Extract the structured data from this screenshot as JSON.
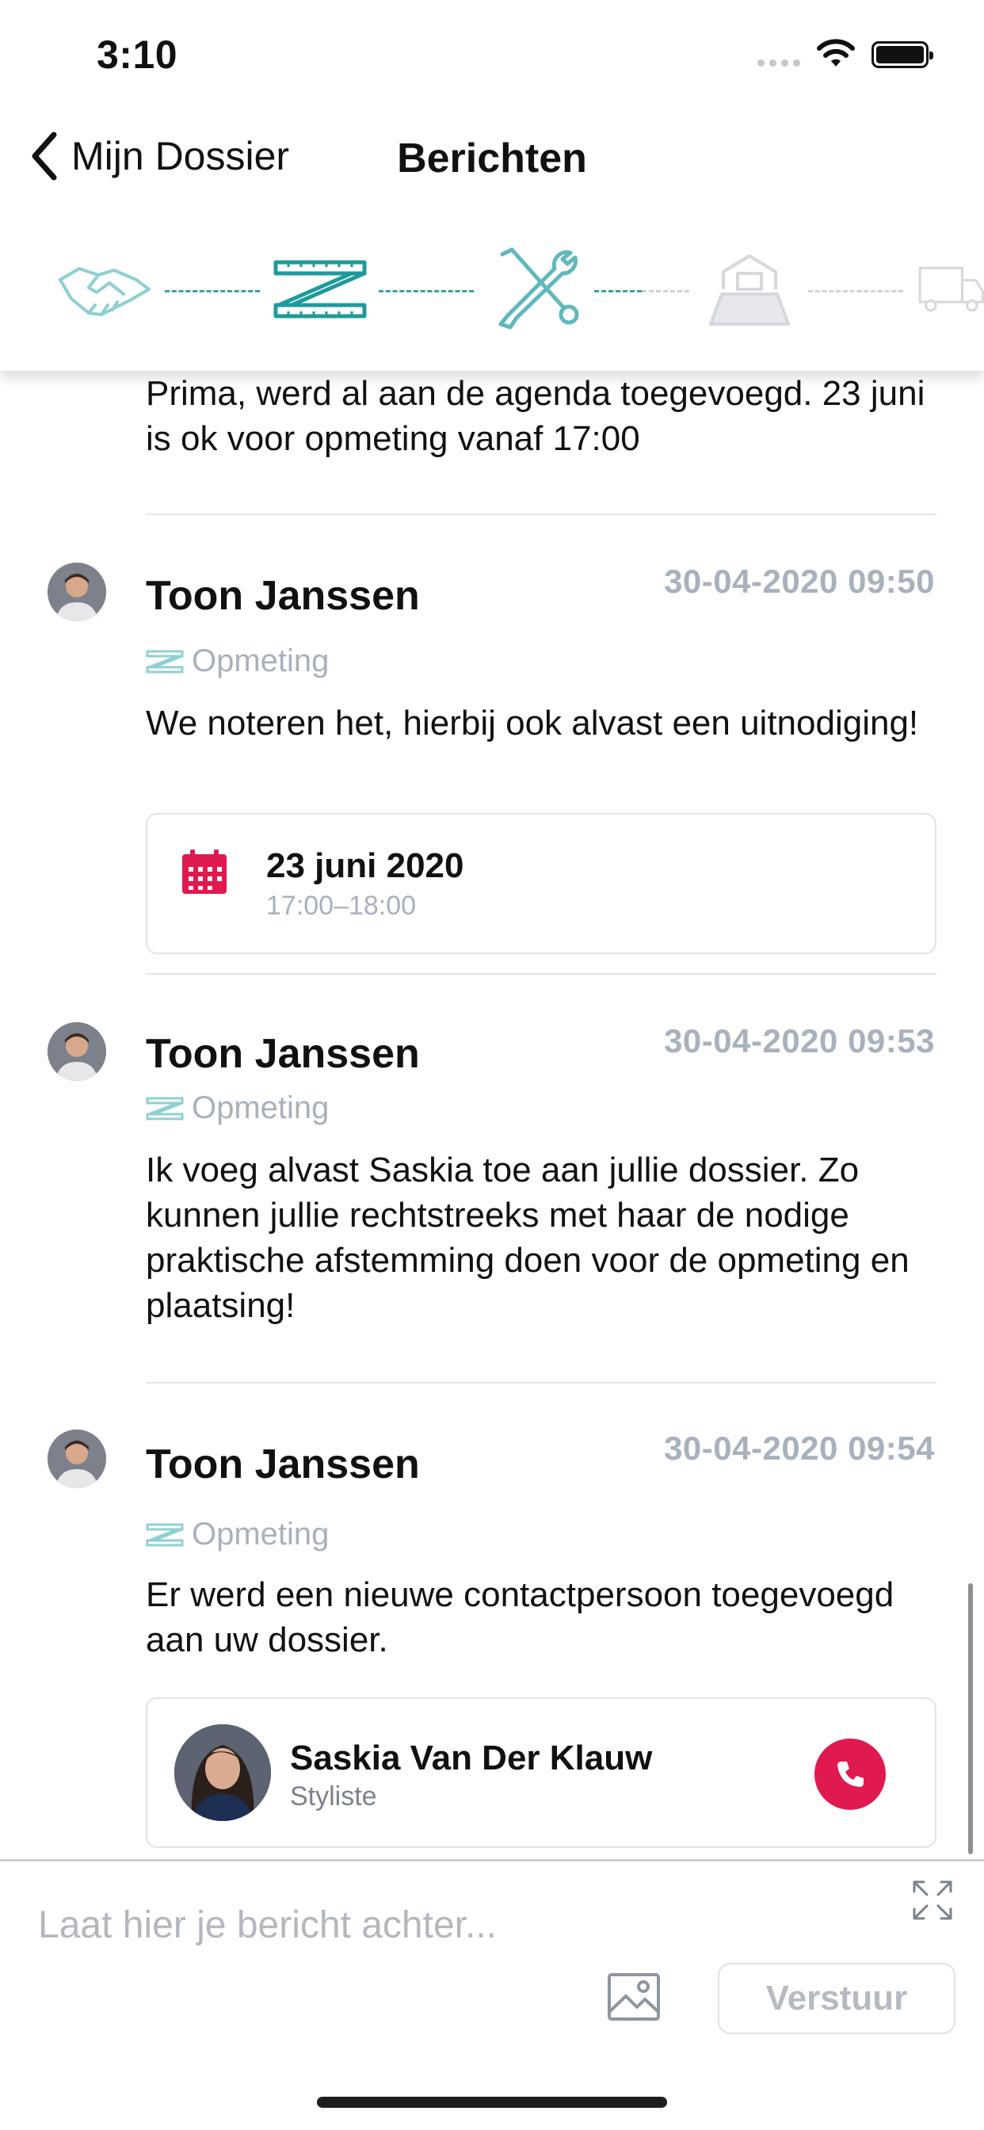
{
  "status_bar": {
    "time": "3:10"
  },
  "nav": {
    "back_label": "Mijn Dossier",
    "title": "Berichten"
  },
  "progress_steps": [
    {
      "icon": "handshake-icon",
      "state": "done"
    },
    {
      "icon": "measuring-tape-icon",
      "state": "current"
    },
    {
      "icon": "tools-icon",
      "state": "done"
    },
    {
      "icon": "kitchen-install-icon",
      "state": "upcoming"
    },
    {
      "icon": "delivery-truck-icon",
      "state": "upcoming"
    }
  ],
  "feed": {
    "partial_message_text": "Prima, werd al aan de agenda toegevoegd. 23 juni is ok voor opmeting vanaf 17:00",
    "messages": [
      {
        "author": "Toon Janssen",
        "timestamp": "30-04-2020 09:50",
        "tag": "Opmeting",
        "text": "We noteren het, hierbij ook alvast een uitnodiging!",
        "calendar": {
          "date": "23 juni 2020",
          "time": "17:00–18:00"
        }
      },
      {
        "author": "Toon Janssen",
        "timestamp": "30-04-2020 09:53",
        "tag": "Opmeting",
        "text": "Ik voeg alvast Saskia toe aan jullie dossier. Zo kunnen jullie rechtstreeks met haar de nodige praktische afstemming doen voor de opmeting en plaatsing!"
      },
      {
        "author": "Toon Janssen",
        "timestamp": "30-04-2020 09:54",
        "tag": "Opmeting",
        "text": "Er werd een nieuwe contactpersoon toegevoegd aan uw dossier.",
        "contact": {
          "name": "Saskia Van Der Klauw",
          "role": "Styliste"
        }
      }
    ]
  },
  "composer": {
    "placeholder": "Laat hier je bericht achter...",
    "send_label": "Verstuur"
  },
  "colors": {
    "teal": "#38a3a5",
    "accent_red": "#e0194f",
    "muted_text": "#a8b1bc"
  }
}
